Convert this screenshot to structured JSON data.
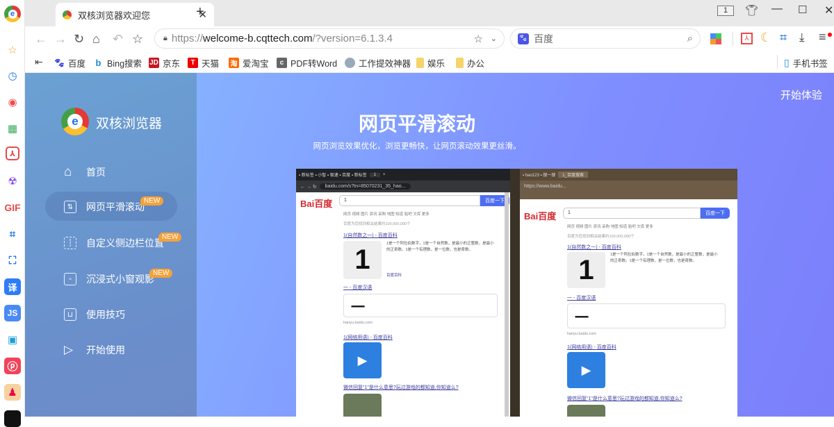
{
  "window": {
    "tab_title": "双核浏览器欢迎您",
    "tab_count": "1"
  },
  "toolbar": {
    "url_scheme": "https://",
    "url_host": "welcome-b.cqttech.com",
    "url_path": "/?version=6.1.3.4",
    "search_engine": "百度"
  },
  "bookmarks": [
    {
      "label": "百度",
      "color": "#2932e1"
    },
    {
      "label": "Bing搜索",
      "color": "#1a8ad8"
    },
    {
      "label": "京东",
      "color": "#c81623"
    },
    {
      "label": "天猫",
      "color": "#e00"
    },
    {
      "label": "爱淘宝",
      "color": "#ff6a00"
    },
    {
      "label": "PDF转Word",
      "color": "#666"
    },
    {
      "label": "工作提效神器",
      "color": "#8aa"
    },
    {
      "label": "娱乐",
      "color": "#f5d46a"
    },
    {
      "label": "办公",
      "color": "#f5d46a"
    }
  ],
  "mobile_bookmarks": "手机书签",
  "panel": {
    "brand": "双核浏览器",
    "menu": [
      {
        "label": "首页",
        "icon": "home-icon",
        "new": false
      },
      {
        "label": "网页平滑滚动",
        "icon": "scroll-icon",
        "new": true
      },
      {
        "label": "自定义侧边栏位置",
        "icon": "sidebar-position-icon",
        "new": true
      },
      {
        "label": "沉浸式小窗观影",
        "icon": "mini-window-icon",
        "new": true
      },
      {
        "label": "使用技巧",
        "icon": "tips-icon",
        "new": false
      },
      {
        "label": "开始使用",
        "icon": "play-icon",
        "new": false
      }
    ],
    "new_badge": "NEW"
  },
  "main": {
    "start_link": "开始体验",
    "title": "网页平滑滚动",
    "subtitle": "网页浏览效果优化，浏览更畅快，让网页滚动效果更丝滑。"
  },
  "preview": {
    "left_url": "baidu.com/s?tn=85070231_35_hao...",
    "right_url": "https://www.baidu...",
    "query": "1",
    "search_btn": "百度一下",
    "logo": "Bai百度",
    "tabs": "网页  视频  图片  资讯  采购  地图  知道  贴吧  文库  更多",
    "count": "百度为您找到相关结果约100,000,000个",
    "results": [
      "1(自然数之一) - 百度百科",
      "一 - 百度汉语",
      "1(网络用语) - 百度百科",
      "微信回复\"1\"是什么意思?玩过游戏的都知道,你知道么?"
    ],
    "snippet": "1是一个阿拉伯数字，1是一个自然数，是最小的正整数，是最小的正奇数。1是一个有理数，是一位数，也是奇数。",
    "source": "百度百科",
    "hanyu": "hanyu.baidu.com"
  },
  "colors": {
    "accent": "#1a73e8",
    "badge": "#f3a23b",
    "panel": "#6a9ed0",
    "main_start": "#86b1ff",
    "main_end": "#7b7ffa"
  }
}
